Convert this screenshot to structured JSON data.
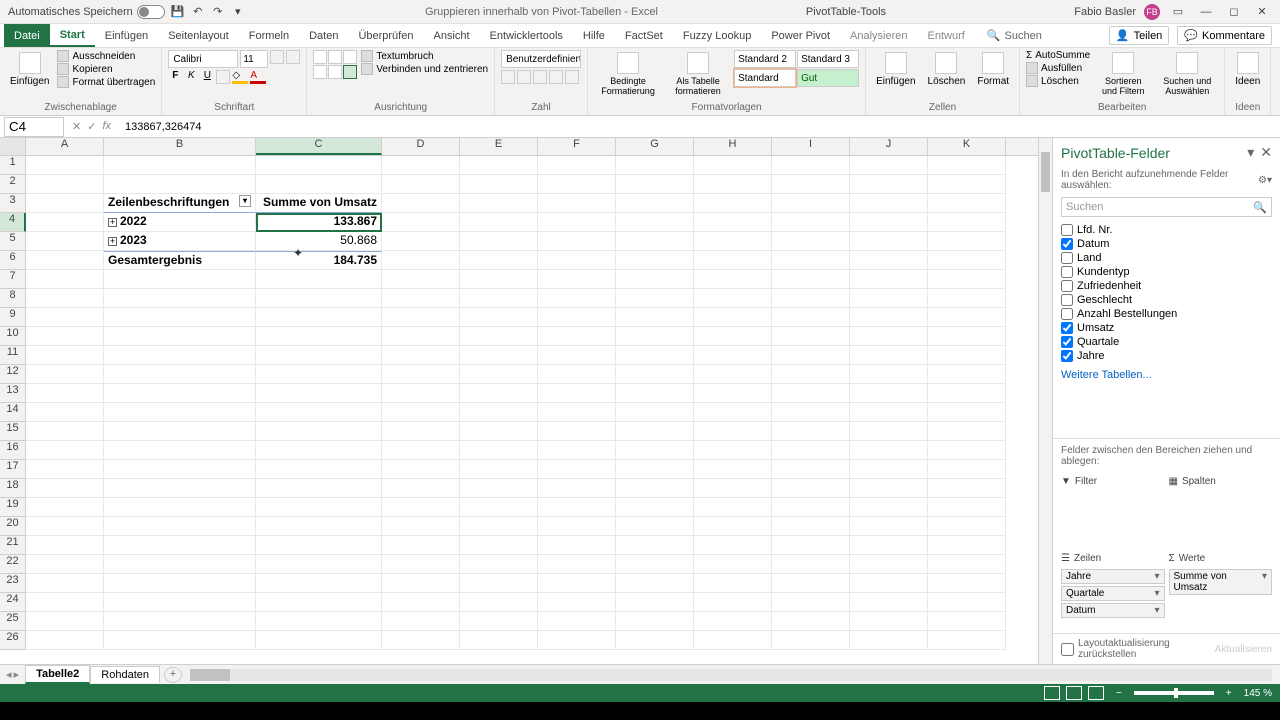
{
  "titlebar": {
    "autosave": "Automatisches Speichern",
    "doc_title": "Gruppieren innerhalb von Pivot-Tabellen - Excel",
    "tool_tab": "PivotTable-Tools",
    "user": "Fabio Basler",
    "avatar": "FB"
  },
  "tabs": {
    "file": "Datei",
    "items": [
      "Start",
      "Einfügen",
      "Seitenlayout",
      "Formeln",
      "Daten",
      "Überprüfen",
      "Ansicht",
      "Entwicklertools",
      "Hilfe",
      "FactSet",
      "Fuzzy Lookup",
      "Power Pivot",
      "Analysieren",
      "Entwurf"
    ],
    "search": "Suchen",
    "share": "Teilen",
    "comments": "Kommentare"
  },
  "ribbon": {
    "clipboard": {
      "paste": "Einfügen",
      "cut": "Ausschneiden",
      "copy": "Kopieren",
      "format_painter": "Format übertragen",
      "label": "Zwischenablage"
    },
    "font": {
      "name": "Calibri",
      "size": "11",
      "label": "Schriftart"
    },
    "align": {
      "wrap": "Textumbruch",
      "merge": "Verbinden und zentrieren",
      "label": "Ausrichtung"
    },
    "number": {
      "format": "Benutzerdefiniert",
      "label": "Zahl"
    },
    "styles": {
      "cond": "Bedingte Formatierung",
      "table": "Als Tabelle formatieren",
      "s1": "Standard 2",
      "s2": "Standard 3",
      "s3": "Standard",
      "s4": "Gut",
      "label": "Formatvorlagen"
    },
    "cells": {
      "insert": "Einfügen",
      "delete": "Löschen",
      "format": "Format",
      "label": "Zellen"
    },
    "editing": {
      "sum": "AutoSumme",
      "fill": "Ausfüllen",
      "clear": "Löschen",
      "sort": "Sortieren und Filtern",
      "find": "Suchen und Auswählen",
      "label": "Bearbeiten"
    },
    "ideas": {
      "btn": "Ideen",
      "label": "Ideen"
    }
  },
  "cell_ref": "C4",
  "formula": "133867,326474",
  "columns": [
    "A",
    "B",
    "C",
    "D",
    "E",
    "F",
    "G",
    "H",
    "I",
    "J",
    "K"
  ],
  "pivot": {
    "row_header": "Zeilenbeschriftungen",
    "val_header": "Summe von Umsatz",
    "rows": [
      {
        "label": "2022",
        "value": "133.867"
      },
      {
        "label": "2023",
        "value": "50.868"
      }
    ],
    "total_label": "Gesamtergebnis",
    "total_value": "184.735"
  },
  "field_pane": {
    "title": "PivotTable-Felder",
    "subtitle": "In den Bericht aufzunehmende Felder auswählen:",
    "search": "Suchen",
    "fields": [
      {
        "name": "Lfd. Nr.",
        "checked": false
      },
      {
        "name": "Datum",
        "checked": true
      },
      {
        "name": "Land",
        "checked": false
      },
      {
        "name": "Kundentyp",
        "checked": false
      },
      {
        "name": "Zufriedenheit",
        "checked": false
      },
      {
        "name": "Geschlecht",
        "checked": false
      },
      {
        "name": "Anzahl Bestellungen",
        "checked": false
      },
      {
        "name": "Umsatz",
        "checked": true
      },
      {
        "name": "Quartale",
        "checked": true
      },
      {
        "name": "Jahre",
        "checked": true
      }
    ],
    "more_tables": "Weitere Tabellen...",
    "drag_label": "Felder zwischen den Bereichen ziehen und ablegen:",
    "areas": {
      "filter": "Filter",
      "columns": "Spalten",
      "rows": "Zeilen",
      "values": "Werte",
      "row_chips": [
        "Jahre",
        "Quartale",
        "Datum"
      ],
      "value_chips": [
        "Summe von Umsatz"
      ]
    },
    "defer": "Layoutaktualisierung zurückstellen",
    "update": "Aktualisieren"
  },
  "sheets": {
    "active": "Tabelle2",
    "other": "Rohdaten"
  },
  "zoom": "145 %"
}
